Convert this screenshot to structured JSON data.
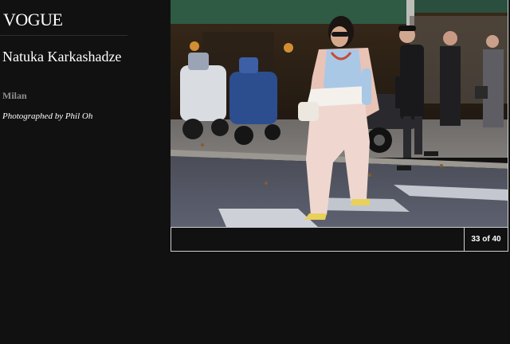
{
  "brand": {
    "logo_text": "VOGUE"
  },
  "gallery": {
    "subject_name": "Natuka Karkashadze",
    "location": "Milan",
    "credit": "Photographed by Phil Oh",
    "caption": "",
    "slide_counter": "33 of 40"
  },
  "photo": {
    "description_icon": "street-style-photo"
  },
  "colors": {
    "background": "#111111",
    "frame_border": "#cfcfcf",
    "location_gray": "#8f8f8f",
    "awning_green": "#2f5a44",
    "blazer_pink": "#e8c3b6",
    "shirt_blue": "#a9c8e6",
    "trousers": "#efd7cf"
  }
}
